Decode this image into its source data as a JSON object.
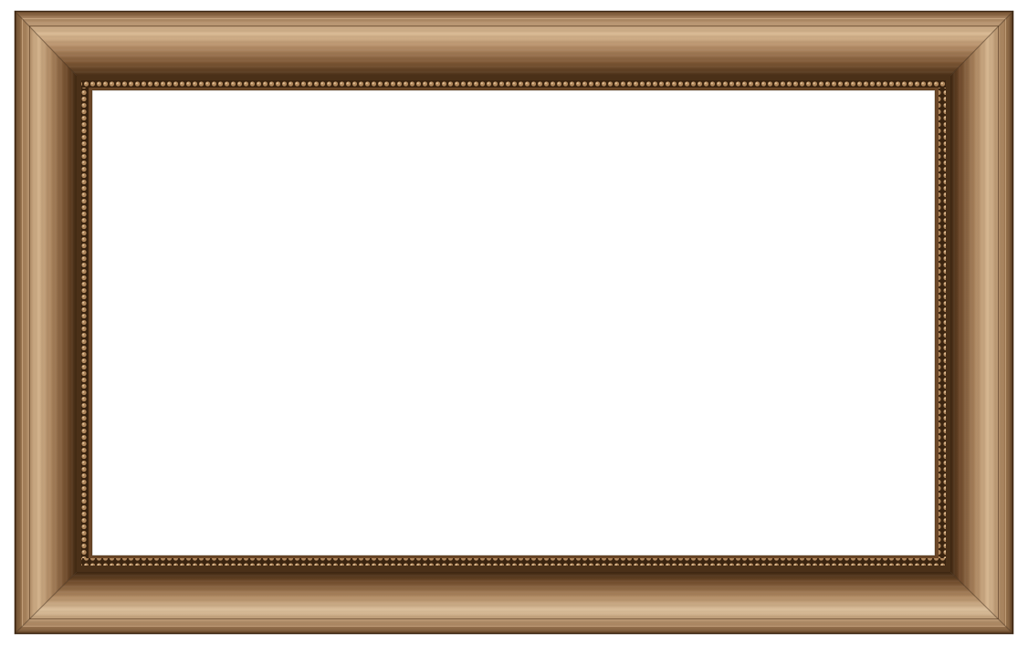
{
  "image": {
    "subject": "picture-frame",
    "finish": "brushed-bronze",
    "ornament": "beaded-inner-lip",
    "colors": {
      "bronze_dark": "#4a3018",
      "bronze_mid": "#8a6240",
      "bronze_light": "#c9a47c",
      "bronze_highlight": "#e6c9a4",
      "bead": "#a67d55",
      "bead_shadow": "#3a2410",
      "opening": "#ffffff",
      "background": "#ffffff"
    }
  }
}
